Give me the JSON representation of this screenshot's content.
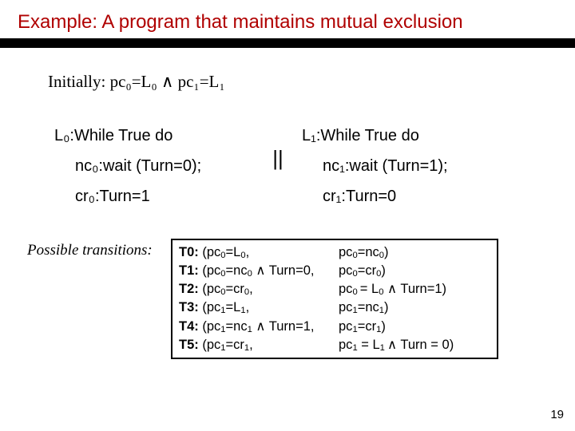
{
  "title": "Example: A program that maintains mutual exclusion",
  "initially": "Initially: pc₀=L₀ ∧ pc₁=L₁",
  "prog0": {
    "head": "L₀:While True do",
    "wait": "nc₀:wait (Turn=0);",
    "cr": "cr₀:Turn=1"
  },
  "parallel": "||",
  "prog1": {
    "head": "L₁:While True do",
    "wait": "nc₁:wait (Turn=1);",
    "cr": "cr₁:Turn=0"
  },
  "trans_label": "Possible transitions:",
  "transitions": {
    "left": [
      "T0: (pc₀=L₀,",
      "T1: (pc₀=nc₀ ∧ Turn=0,",
      "T2: (pc₀=cr₀,",
      "T3: (pc₁=L₁,",
      "T4: (pc₁=nc₁ ∧ Turn=1,",
      "T5: (pc₁=cr₁,"
    ],
    "right": [
      "pc₀=nc₀)",
      "pc₀=cr₀)",
      "pc₀ = L₀ ∧ Turn=1)",
      "pc₁=nc₁)",
      "pc₁=cr₁)",
      "pc₁ = L₁ ∧ Turn = 0)"
    ]
  },
  "page": "19"
}
